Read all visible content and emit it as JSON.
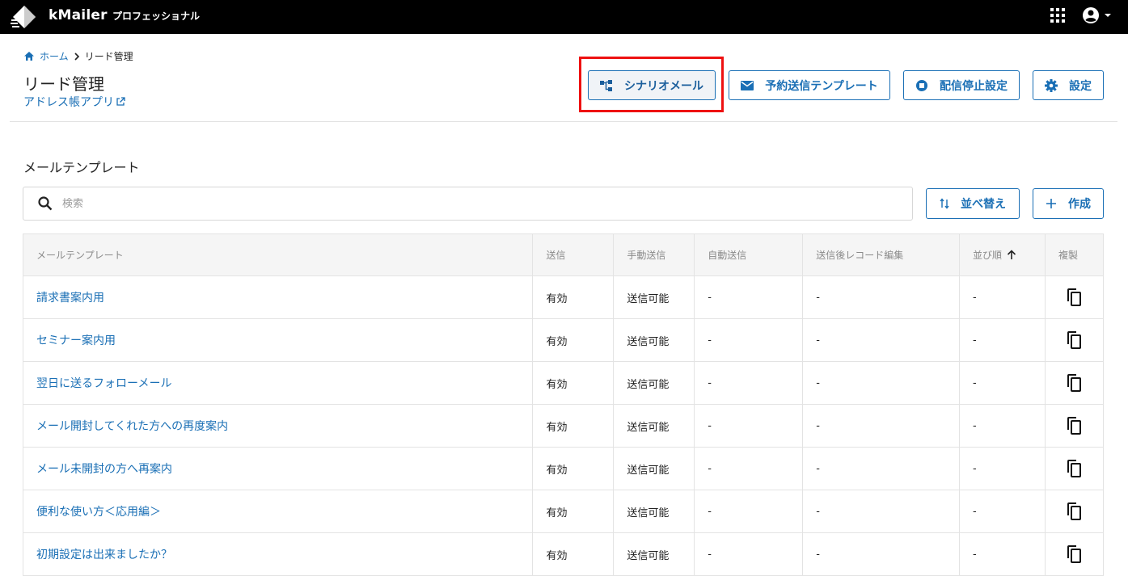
{
  "app": {
    "brand": "kMailer",
    "edition": "プロフェッショナル"
  },
  "breadcrumb": {
    "home": "ホーム",
    "current": "リード管理"
  },
  "page": {
    "title": "リード管理",
    "sub_link": "アドレス帳アプリ"
  },
  "actions": {
    "scenario": "シナリオメール",
    "reserve": "予約送信テンプレート",
    "unsubscribe": "配信停止設定",
    "settings": "設定"
  },
  "section": {
    "title": "メールテンプレート"
  },
  "search": {
    "placeholder": "検索",
    "value": ""
  },
  "list_actions": {
    "sort": "並べ替え",
    "create": "作成"
  },
  "table": {
    "headers": {
      "name": "メールテンプレート",
      "send": "送信",
      "manual": "手動送信",
      "auto": "自動送信",
      "edit_after": "送信後レコード編集",
      "order": "並び順",
      "copy": "複製"
    },
    "rows": [
      {
        "name": "請求書案内用",
        "send": "有効",
        "manual": "送信可能",
        "auto": "-",
        "edit_after": "-",
        "order": "-"
      },
      {
        "name": "セミナー案内用",
        "send": "有効",
        "manual": "送信可能",
        "auto": "-",
        "edit_after": "-",
        "order": "-"
      },
      {
        "name": "翌日に送るフォローメール",
        "send": "有効",
        "manual": "送信可能",
        "auto": "-",
        "edit_after": "-",
        "order": "-"
      },
      {
        "name": "メール開封してくれた方への再度案内",
        "send": "有効",
        "manual": "送信可能",
        "auto": "-",
        "edit_after": "-",
        "order": "-"
      },
      {
        "name": "メール未開封の方へ再案内",
        "send": "有効",
        "manual": "送信可能",
        "auto": "-",
        "edit_after": "-",
        "order": "-"
      },
      {
        "name": "便利な使い方＜応用編＞",
        "send": "有効",
        "manual": "送信可能",
        "auto": "-",
        "edit_after": "-",
        "order": "-"
      },
      {
        "name": "初期設定は出来ましたか？",
        "send": "有効",
        "manual": "送信可能",
        "auto": "-",
        "edit_after": "-",
        "order": "-"
      }
    ]
  },
  "colors": {
    "accent": "#1a6fb5",
    "highlight": "#e11111",
    "topbar": "#000000"
  }
}
